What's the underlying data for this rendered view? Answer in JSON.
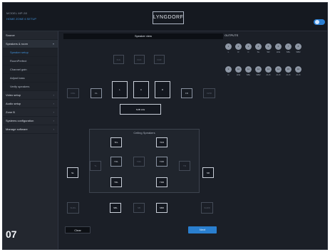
{
  "header": {
    "model": "MODEL MP-50",
    "breadcrumb": "HOME  ZONE 6  SETUP",
    "logo": "LYNGDORF"
  },
  "sidebar": {
    "items": [
      {
        "label": "Source",
        "arrow": ""
      },
      {
        "label": "Speakers & room",
        "arrow": "▾"
      },
      {
        "label": "Speaker setup",
        "arrow": ""
      },
      {
        "label": "RoomPerfect",
        "arrow": ""
      },
      {
        "label": "Channel gain",
        "arrow": ""
      },
      {
        "label": "Adjust bass",
        "arrow": ""
      },
      {
        "label": "Verify speakers",
        "arrow": ""
      },
      {
        "label": "Video setup",
        "arrow": "›"
      },
      {
        "label": "Audio setup",
        "arrow": "›"
      },
      {
        "label": "Zone B",
        "arrow": "›"
      },
      {
        "label": "Systems configuration",
        "arrow": "›"
      },
      {
        "label": "Manage software",
        "arrow": "›"
      }
    ]
  },
  "speaker_view": {
    "title": "Speaker view",
    "ceiling_title": "Ceiling Speakers",
    "front_top": [
      "FHL",
      "FHC",
      "FHR"
    ],
    "fw_left": "FWL",
    "fw_right": "FWR",
    "fl": "FL",
    "fr": "FR",
    "left": "L",
    "center": "C",
    "right": "R",
    "sub": "SUB LFE",
    "sl": "SL",
    "sr": "SR",
    "tlfc": "TFL",
    "tfr": "TFR",
    "tml": "TML",
    "tmc": "TMC",
    "tmr": "TMR",
    "trl": "TRL",
    "trr": "TRR",
    "tl": "TL",
    "tr": "TR",
    "surl": "SBL",
    "surc": "SB",
    "surr": "SBR",
    "sbl_w": "SURL",
    "sbr_w": "SURR"
  },
  "outputs": {
    "title": "OUTPUTS",
    "row1": [
      {
        "ch": "1",
        "lbl": "L"
      },
      {
        "ch": "2",
        "lbl": "R"
      },
      {
        "ch": "3",
        "lbl": "C"
      },
      {
        "ch": "4",
        "lbl": "SL"
      },
      {
        "ch": "5",
        "lbl": "SR"
      },
      {
        "ch": "6",
        "lbl": "LFE"
      },
      {
        "ch": "7",
        "lbl": "SBL"
      },
      {
        "ch": "8",
        "lbl": "SBR"
      }
    ],
    "row2": [
      {
        "ch": "9",
        "lbl": "C"
      },
      {
        "ch": "10",
        "lbl": "LFE"
      },
      {
        "ch": "11",
        "lbl": "SBL"
      },
      {
        "ch": "12",
        "lbl": "SBR"
      },
      {
        "ch": "13",
        "lbl": "AUX"
      },
      {
        "ch": "14",
        "lbl": "AUX"
      },
      {
        "ch": "15",
        "lbl": "AUX"
      },
      {
        "ch": "16",
        "lbl": "AUX"
      }
    ]
  },
  "actions": {
    "clear": "Clear",
    "next": "Next"
  },
  "badge": "07",
  "colors": {
    "accent": "#2a7fcf",
    "bg": "#1b1f27"
  }
}
